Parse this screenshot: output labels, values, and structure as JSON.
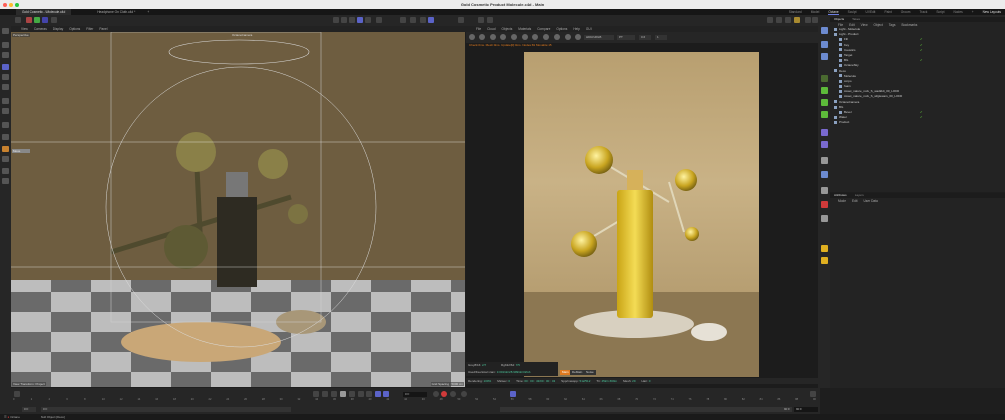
{
  "window": {
    "title": "Gold Cosmetic Product Molecule.c4d - Main"
  },
  "tabs": [
    {
      "label": "Gold Cosmetic...\\Molecule.c4d",
      "active": true
    },
    {
      "label": "Headphone On Cloth.c4d *",
      "active": false
    }
  ],
  "layouts": {
    "items": [
      "Standard",
      "Model",
      "Octane",
      "Sculpt",
      "UVEdit",
      "Paint",
      "Groom",
      "Track",
      "Script",
      "Nodes"
    ],
    "active": "Octane",
    "add": "+",
    "new_layouts": "New Layouts"
  },
  "viewport": {
    "menu": [
      "View",
      "Cameras",
      "Display",
      "Options",
      "Filter",
      "Panel"
    ],
    "camera_label": "Perspective",
    "camera_target": "OctaneCamera",
    "transform_label": "View Transform: Project",
    "grid_spacing": "Grid Spacing : 5000 cm",
    "move_field": "Move"
  },
  "octane": {
    "menu": [
      "File",
      "Cloud",
      "Objects",
      "Materials",
      "Compare",
      "Options",
      "Help",
      "GUI"
    ],
    "colorspace": "HDR/sRGB",
    "channel": "PT",
    "exposure": "0.6",
    "value": "1",
    "status": "Check:0ms. Mesh:0ms. Update[0]:0ms. Nodes:81 Movable:15",
    "info": {
      "gray_label": "Grey8/16:",
      "gray_value": "2/7",
      "rgb_label": "Rgb32/64:",
      "rgb_value": "7/5",
      "vram_label": "Used/free/total vram:",
      "vram_value": "3.001Gb/28.999Gb/32Gb"
    },
    "passes": [
      "Main",
      "DeMain",
      "Noise"
    ],
    "active_pass": "Main",
    "render_line": [
      {
        "label": "Rendering:",
        "value": "100%"
      },
      {
        "label": "Ms/sec:",
        "value": "0"
      },
      {
        "label": "Time:",
        "value": "00 : 00 : 43/00 : 00 : 43"
      },
      {
        "label": "Spp/maxspp:",
        "value": "512/512"
      },
      {
        "label": "Tri:",
        "value": "45k/1.669m"
      },
      {
        "label": "Mesh:",
        "value": "29"
      },
      {
        "label": "Hair:",
        "value": "0"
      }
    ]
  },
  "objects_panel": {
    "tabs": [
      "Objects",
      "Takes"
    ],
    "active_tab": "Objects",
    "menu": [
      "File",
      "Edit",
      "View",
      "Object",
      "Tags",
      "Bookmarks"
    ],
    "items": [
      {
        "name": "Light - Molecule",
        "depth": 0,
        "check": false
      },
      {
        "name": "Light - Product",
        "depth": 0,
        "check": false
      },
      {
        "name": "Fill",
        "depth": 1,
        "check": true
      },
      {
        "name": "Key",
        "depth": 1,
        "check": true
      },
      {
        "name": "Caustics",
        "depth": 1,
        "check": true
      },
      {
        "name": "Target",
        "depth": 1,
        "check": false
      },
      {
        "name": "BG",
        "depth": 1,
        "check": true
      },
      {
        "name": "OctaneSky",
        "depth": 1,
        "check": false
      },
      {
        "name": "Deco",
        "depth": 0,
        "check": false
      },
      {
        "name": "Molecule",
        "depth": 1,
        "check": false
      },
      {
        "name": "corpo",
        "depth": 1,
        "check": false
      },
      {
        "name": "foam",
        "depth": 1,
        "check": false
      },
      {
        "name": "Asset_nature_rock_S_wadlddi_00_LOD0",
        "depth": 1,
        "check": false
      },
      {
        "name": "Asset_nature_rock_S_wfglewars_00_LOD0",
        "depth": 1,
        "check": false
      },
      {
        "name": "OctaneCamera",
        "depth": 0,
        "check": false
      },
      {
        "name": "BG",
        "depth": 0,
        "check": false
      },
      {
        "name": "Bevel",
        "depth": 1,
        "check": true
      },
      {
        "name": "Water",
        "depth": 0,
        "check": true
      },
      {
        "name": "Product",
        "depth": 0,
        "check": false
      }
    ]
  },
  "attributes_panel": {
    "tabs": [
      "Attributes",
      "Layers"
    ],
    "active_tab": "Attributes",
    "menu": [
      "Mode",
      "Edit",
      "User Data"
    ]
  },
  "timeline": {
    "ticks": [
      "0",
      "2",
      "4",
      "6",
      "8",
      "10",
      "12",
      "14",
      "16",
      "18",
      "20",
      "22",
      "24",
      "26",
      "28",
      "30",
      "32",
      "34",
      "36",
      "38",
      "40",
      "42",
      "44",
      "46",
      "48",
      "50",
      "52",
      "54",
      "56",
      "58",
      "60",
      "62",
      "64",
      "66",
      "68",
      "70",
      "72",
      "74",
      "76",
      "78",
      "80",
      "82",
      "84",
      "86",
      "88",
      "90"
    ],
    "current_frame": "0 F",
    "start": "0 F",
    "start2": "0 F",
    "end": "90 F",
    "end2": "90 F"
  },
  "statusbar": {
    "renderer": "Octane",
    "message": "Null Object [Deco]"
  },
  "colors": {
    "accent": "#5b63c8",
    "octane_orange": "#e07a1f",
    "check_green": "#5dbb3a"
  }
}
